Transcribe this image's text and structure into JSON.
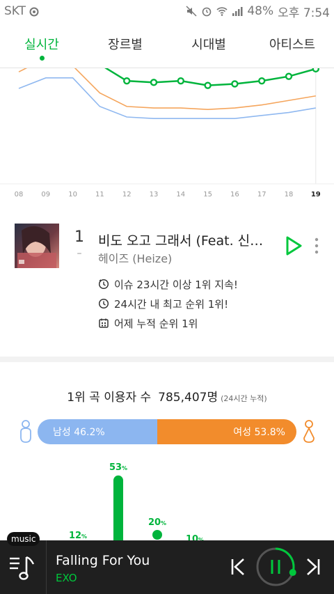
{
  "status_bar": {
    "carrier": "SKT",
    "battery": "48%",
    "time": "오후 7:54"
  },
  "tabs": [
    {
      "label": "실시간",
      "active": true
    },
    {
      "label": "장르별",
      "active": false
    },
    {
      "label": "시대별",
      "active": false
    },
    {
      "label": "아티스트",
      "active": false
    }
  ],
  "chart_data": {
    "type": "line",
    "x": [
      "08",
      "09",
      "10",
      "11",
      "12",
      "13",
      "14",
      "15",
      "16",
      "17",
      "18",
      "19"
    ],
    "highlighted_x": "19",
    "grid": false,
    "series": [
      {
        "color": "#00b43c",
        "markers": true,
        "values": [
          null,
          null,
          null,
          85,
          74,
          73,
          74,
          71,
          72,
          74,
          77,
          82
        ]
      },
      {
        "color": "#f5a55c",
        "markers": false,
        "values": [
          80,
          89,
          84,
          66,
          57,
          56,
          56,
          55,
          56,
          58,
          61,
          64
        ]
      },
      {
        "color": "#8fb8f0",
        "markers": false,
        "values": [
          69,
          76,
          76,
          57,
          50,
          49,
          49,
          49,
          49,
          51,
          53,
          56
        ]
      }
    ],
    "ylim": [
      0,
      100
    ]
  },
  "song": {
    "rank": "1",
    "rank_change": "–",
    "title": "비도 오고 그래서 (Feat. 신용재)",
    "artist": "헤이즈 (Heize)",
    "facts": [
      {
        "icon": "issue-clock-icon",
        "text": "이슈 23시간 이상 1위 지속!"
      },
      {
        "icon": "clock-icon",
        "text": "24시간 내 최고 순위 1위!"
      },
      {
        "icon": "calendar-icon",
        "text": "어제 누적 순위 1위"
      }
    ]
  },
  "stats": {
    "users_label": "1위 곡 이용자 수",
    "users_count": "785,407명",
    "users_note": "(24시간 누적)",
    "male_label": "남성 46.2%",
    "female_label": "여성 53.8%",
    "male_pct": 46.2,
    "female_pct": 53.8,
    "male_color": "#8cb6f0",
    "female_color": "#f28c2c"
  },
  "age_chart": {
    "color": "#00b43c",
    "values": [
      12,
      53,
      20,
      10
    ],
    "labels": [
      "12",
      "53",
      "20",
      "10"
    ],
    "unit": "%"
  },
  "player": {
    "tag": "music",
    "title": "Falling For You",
    "artist": "EXO",
    "progress": 0.3,
    "accent": "#00c73c"
  }
}
